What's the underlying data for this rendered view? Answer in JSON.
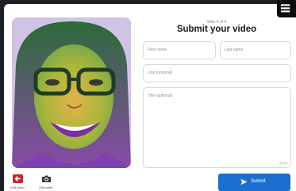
{
  "header": {
    "step": "Step 4 of 4",
    "title": "Submit your video"
  },
  "form": {
    "first_name_placeholder": "First name",
    "last_name_placeholder": "Last name",
    "link_placeholder": "Link (optional)",
    "title_placeholder": "Title (optional)",
    "char_counter": "0/100"
  },
  "toolbar": {
    "edit_video_label": "Edit video",
    "edit_selfie_label": "Edit selfie"
  },
  "submit": {
    "label": "Submit"
  },
  "icons": {
    "back": "arrow-left-icon",
    "camera": "camera-icon",
    "send": "send-icon",
    "corner": "badge-icon"
  },
  "colors": {
    "accent": "#1b6fd1",
    "back_icon": "#c62533"
  }
}
